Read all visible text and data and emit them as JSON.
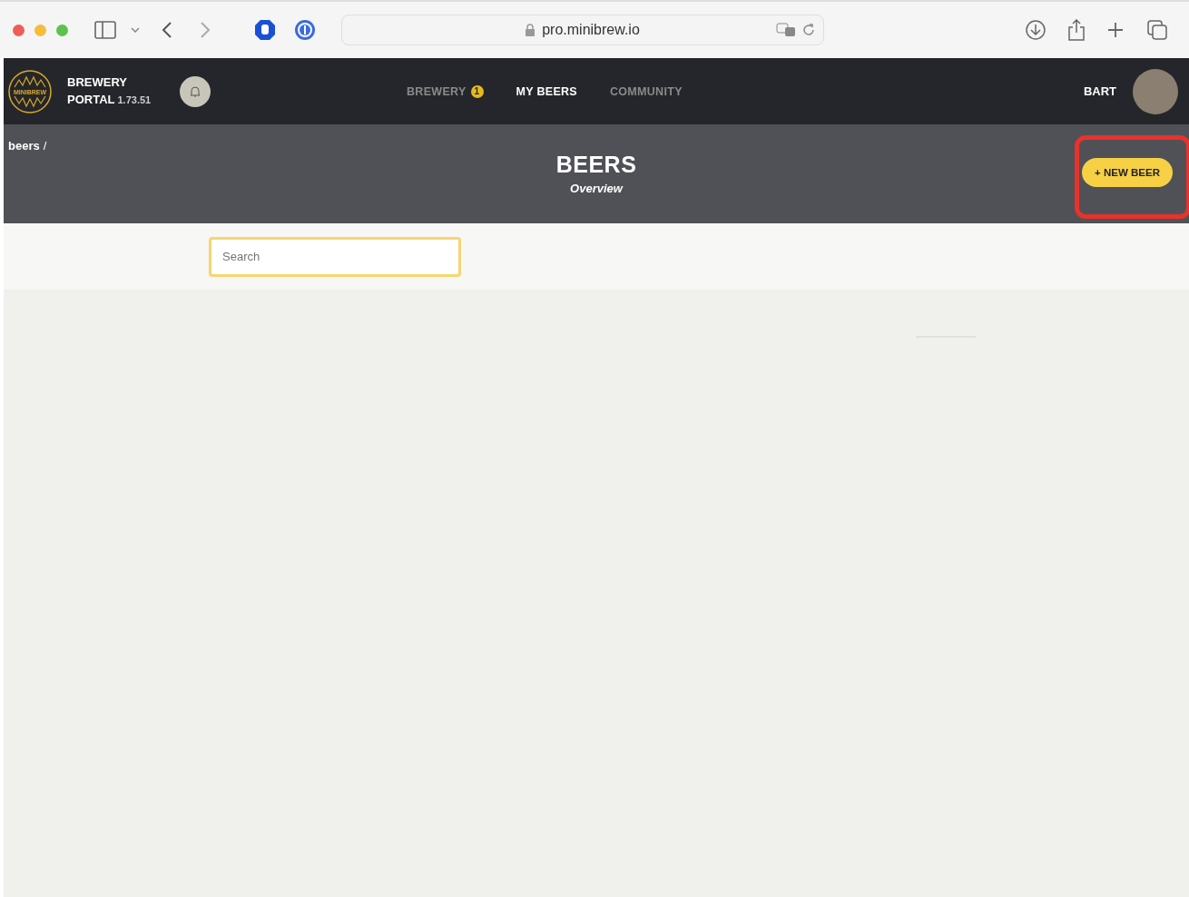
{
  "browser": {
    "url": "pro.minibrew.io"
  },
  "header": {
    "logo_text": "MINIBREW",
    "title_line1": "BREWERY",
    "title_line2": "PORTAL",
    "version": "1.73.51",
    "nav": [
      {
        "label": "BREWERY",
        "badge": "1",
        "selected": false
      },
      {
        "label": "MY BEERS",
        "selected": true
      },
      {
        "label": "COMMUNITY",
        "selected": false
      }
    ],
    "user": "BART"
  },
  "breadcrumb": {
    "item": "beers",
    "separator": "/"
  },
  "page": {
    "title": "BEERS",
    "subtitle": "Overview",
    "new_button": "+ NEW BEER"
  },
  "search": {
    "placeholder": "Search"
  }
}
